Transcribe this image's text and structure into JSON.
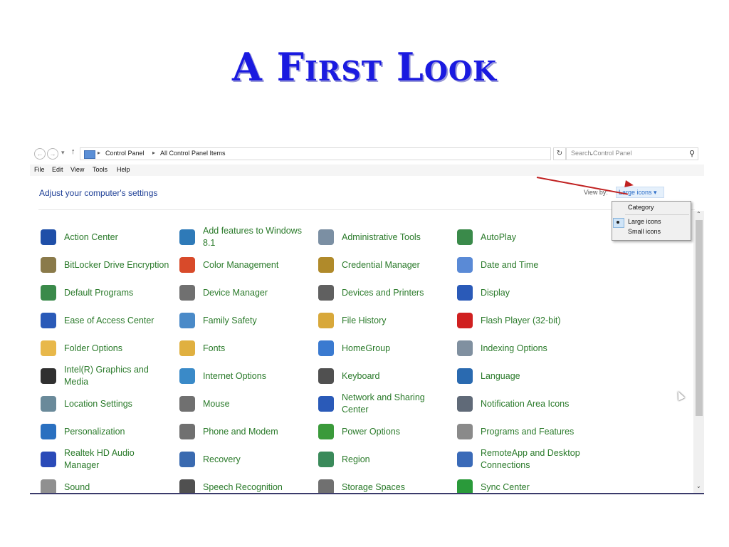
{
  "slide": {
    "title": "A First Look"
  },
  "address": {
    "crumbs": [
      "Control Panel",
      "All Control Panel Items"
    ],
    "search_placeholder": "Search Control Panel"
  },
  "menu": [
    "File",
    "Edit",
    "View",
    "Tools",
    "Help"
  ],
  "header": {
    "adjust": "Adjust your computer's settings",
    "view_by_label": "View by:",
    "view_by_value": "Large icons ▾"
  },
  "dropdown": {
    "options": [
      "Category",
      "Large icons",
      "Small icons"
    ],
    "selected": "Large icons"
  },
  "items": [
    {
      "label": "Action Center",
      "icon": "flag-icon",
      "color": "#1f4fa8"
    },
    {
      "label": "Add features to Windows 8.1",
      "icon": "add-features-icon",
      "color": "#2e7ab8"
    },
    {
      "label": "Administrative Tools",
      "icon": "admin-tools-icon",
      "color": "#7b8fa3"
    },
    {
      "label": "AutoPlay",
      "icon": "autoplay-icon",
      "color": "#3a8a4a"
    },
    {
      "label": "BitLocker Drive Encryption",
      "icon": "bitlocker-icon",
      "color": "#8a7a4a"
    },
    {
      "label": "Color Management",
      "icon": "color-management-icon",
      "color": "#d84a2a"
    },
    {
      "label": "Credential Manager",
      "icon": "credential-icon",
      "color": "#b08a2a"
    },
    {
      "label": "Date and Time",
      "icon": "clock-icon",
      "color": "#5a8ad6"
    },
    {
      "label": "Default Programs",
      "icon": "default-programs-icon",
      "color": "#3a8a4a"
    },
    {
      "label": "Device Manager",
      "icon": "device-manager-icon",
      "color": "#707070"
    },
    {
      "label": "Devices and Printers",
      "icon": "printer-icon",
      "color": "#606060"
    },
    {
      "label": "Display",
      "icon": "display-icon",
      "color": "#2a5ab8"
    },
    {
      "label": "Ease of Access Center",
      "icon": "ease-of-access-icon",
      "color": "#2a5ab8"
    },
    {
      "label": "Family Safety",
      "icon": "family-safety-icon",
      "color": "#4a8ac8"
    },
    {
      "label": "File History",
      "icon": "file-history-icon",
      "color": "#d8a83a"
    },
    {
      "label": "Flash Player (32-bit)",
      "icon": "flash-icon",
      "color": "#d02020"
    },
    {
      "label": "Folder Options",
      "icon": "folder-icon",
      "color": "#e8b84a"
    },
    {
      "label": "Fonts",
      "icon": "fonts-icon",
      "color": "#e0b040"
    },
    {
      "label": "HomeGroup",
      "icon": "homegroup-icon",
      "color": "#3a7ad0"
    },
    {
      "label": "Indexing Options",
      "icon": "indexing-icon",
      "color": "#8090a0"
    },
    {
      "label": "Intel(R) Graphics and Media",
      "icon": "intel-graphics-icon",
      "color": "#303030"
    },
    {
      "label": "Internet Options",
      "icon": "globe-icon",
      "color": "#3a8ac8"
    },
    {
      "label": "Keyboard",
      "icon": "keyboard-icon",
      "color": "#505050"
    },
    {
      "label": "Language",
      "icon": "language-icon",
      "color": "#2a6ab0"
    },
    {
      "label": "Location Settings",
      "icon": "location-icon",
      "color": "#6a8a9a"
    },
    {
      "label": "Mouse",
      "icon": "mouse-icon",
      "color": "#707070"
    },
    {
      "label": "Network and Sharing Center",
      "icon": "network-icon",
      "color": "#2a5ab8"
    },
    {
      "label": "Notification Area Icons",
      "icon": "notification-icon",
      "color": "#606a78"
    },
    {
      "label": "Personalization",
      "icon": "personalization-icon",
      "color": "#2a70c0"
    },
    {
      "label": "Phone and Modem",
      "icon": "phone-icon",
      "color": "#707070"
    },
    {
      "label": "Power Options",
      "icon": "power-icon",
      "color": "#3a9a3a"
    },
    {
      "label": "Programs and Features",
      "icon": "programs-icon",
      "color": "#8a8a8a"
    },
    {
      "label": "Realtek HD Audio Manager",
      "icon": "audio-manager-icon",
      "color": "#2a4ab8"
    },
    {
      "label": "Recovery",
      "icon": "recovery-icon",
      "color": "#3a6ab0"
    },
    {
      "label": "Region",
      "icon": "region-icon",
      "color": "#3a8a5a"
    },
    {
      "label": "RemoteApp and Desktop Connections",
      "icon": "remoteapp-icon",
      "color": "#3a6ab8"
    },
    {
      "label": "Sound",
      "icon": "sound-icon",
      "color": "#909090"
    },
    {
      "label": "Speech Recognition",
      "icon": "microphone-icon",
      "color": "#505050"
    },
    {
      "label": "Storage Spaces",
      "icon": "storage-icon",
      "color": "#707070"
    },
    {
      "label": "Sync Center",
      "icon": "sync-icon",
      "color": "#2a9a3a"
    }
  ]
}
